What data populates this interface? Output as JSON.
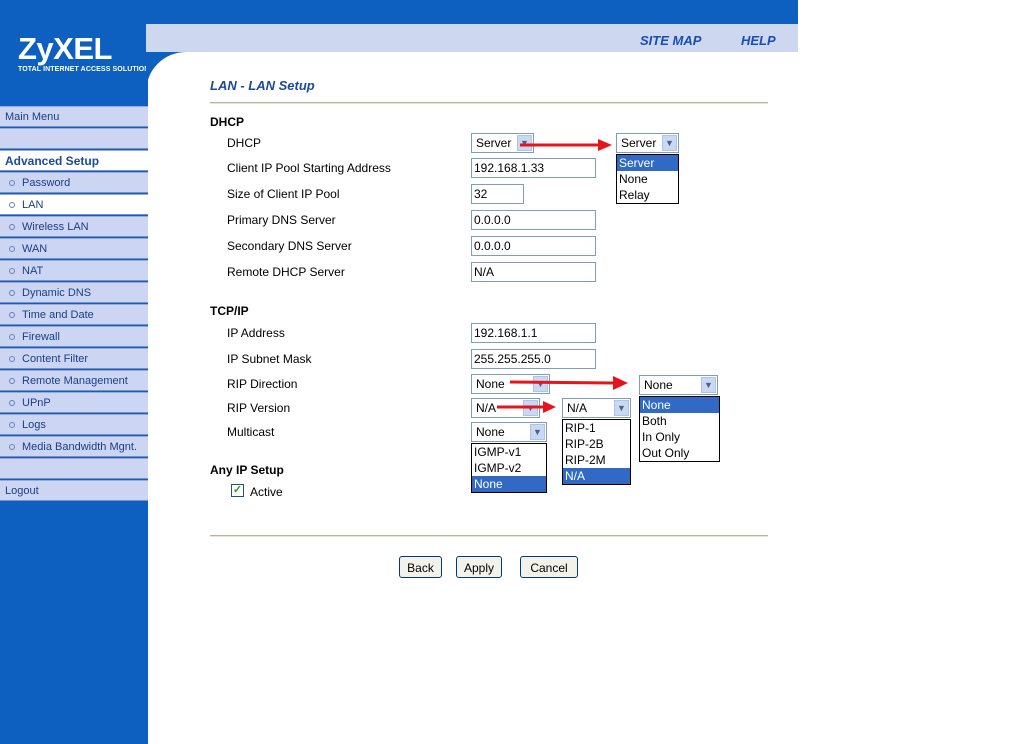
{
  "brand": {
    "logo": "ZyXEL",
    "tagline": "TOTAL INTERNET ACCESS SOLUTION"
  },
  "top_nav": {
    "site_map": "SITE MAP",
    "help": "HELP"
  },
  "sidebar": {
    "main_menu": "Main Menu",
    "advanced_setup": "Advanced Setup",
    "items": [
      "Password",
      "LAN",
      "Wireless LAN",
      "WAN",
      "NAT",
      "Dynamic DNS",
      "Time and Date",
      "Firewall",
      "Content Filter",
      "Remote Management",
      "UPnP",
      "Logs",
      "Media Bandwidth Mgnt."
    ],
    "selected": "LAN",
    "logout": "Logout"
  },
  "page": {
    "title": "LAN - LAN Setup",
    "dhcp": {
      "section": "DHCP",
      "dhcp_label": "DHCP",
      "dhcp_value": "Server",
      "dhcp_options": [
        "Server",
        "None",
        "Relay"
      ],
      "dhcp_selected": "Server",
      "pool_start_label": "Client IP Pool Starting Address",
      "pool_start_value": "192.168.1.33",
      "pool_size_label": "Size of Client IP Pool",
      "pool_size_value": "32",
      "primary_dns_label": "Primary DNS Server",
      "primary_dns_value": "0.0.0.0",
      "secondary_dns_label": "Secondary DNS Server",
      "secondary_dns_value": "0.0.0.0",
      "remote_dhcp_label": "Remote DHCP Server",
      "remote_dhcp_value": "N/A"
    },
    "tcpip": {
      "section": "TCP/IP",
      "ip_label": "IP Address",
      "ip_value": "192.168.1.1",
      "mask_label": "IP Subnet Mask",
      "mask_value": "255.255.255.0",
      "rip_dir_label": "RIP Direction",
      "rip_dir_value": "None",
      "rip_dir_options": [
        "None",
        "Both",
        "In Only",
        "Out Only"
      ],
      "rip_dir_selected": "None",
      "rip_ver_label": "RIP Version",
      "rip_ver_value": "N/A",
      "rip_ver_options": [
        "RIP-1",
        "RIP-2B",
        "RIP-2M",
        "N/A"
      ],
      "rip_ver_selected": "N/A",
      "multicast_label": "Multicast",
      "multicast_value": "None",
      "multicast_options": [
        "IGMP-v1",
        "IGMP-v2",
        "None"
      ],
      "multicast_selected": "None"
    },
    "any_ip": {
      "section": "Any IP Setup",
      "active_label": "Active",
      "active_checked": true
    },
    "buttons": {
      "back": "Back",
      "apply": "Apply",
      "cancel": "Cancel"
    }
  },
  "colors": {
    "header_blue": "#0d5fc0",
    "nav_band": "#cdd7f0",
    "sidebar_item": "#ccd6f2",
    "title_blue": "#1b4a9a",
    "highlight": "#316ac5",
    "arrow_red": "#e8141c"
  },
  "icons": {
    "checkbox": "check-icon",
    "dropdown": "chevron-down-icon",
    "annotation": "red-arrow-icon"
  }
}
